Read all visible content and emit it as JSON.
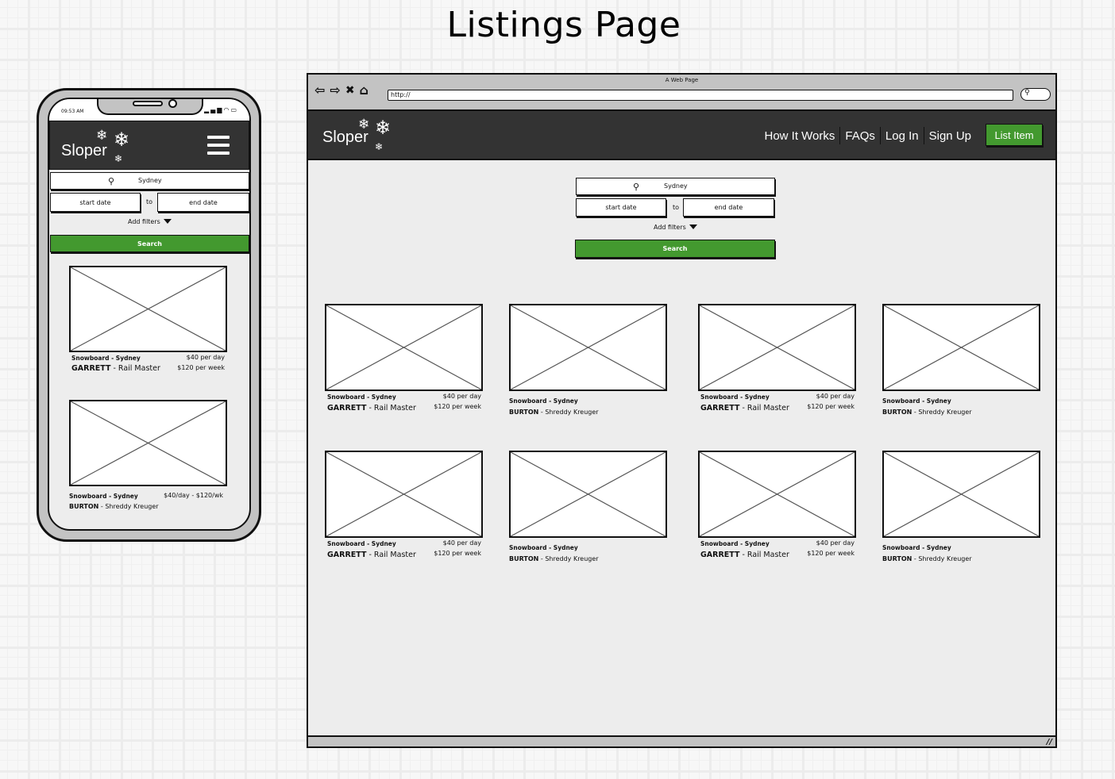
{
  "page_title": "Listings Page",
  "colors": {
    "header_bg": "#333333",
    "accent_green": "#43992f",
    "content_bg": "#ededed",
    "chrome_gray": "#c3c3c3"
  },
  "mobile": {
    "status_time": "09:53 AM",
    "status_icons": [
      "signal-icon",
      "wifi-icon",
      "battery-icon"
    ],
    "brand": "Sloper",
    "menu_icon": "hamburger-menu-icon",
    "search_value": "Sydney",
    "start_date_placeholder": "start date",
    "to_label": "to",
    "end_date_placeholder": "end date",
    "add_filters": "Add filters",
    "search_button": "Search",
    "listings": [
      {
        "category": "Snowboard - Sydney",
        "brand": "GARRETT",
        "model": " - Rail Master",
        "price_day": "$40 per day",
        "price_week": "$120 per week"
      },
      {
        "category": "Snowboard - Sydney",
        "brand": "BURTON",
        "model": " - Shreddy Kreuger",
        "price_combined": "$40/day - $120/wk"
      }
    ]
  },
  "desktop": {
    "window_title": "A Web Page",
    "url": "http://",
    "nav_buttons": [
      "back-icon",
      "forward-icon",
      "close-icon",
      "home-icon"
    ],
    "brand": "Sloper",
    "nav_links": [
      "How It Works",
      "FAQs",
      "Log In",
      "Sign Up"
    ],
    "cta_button": "List Item",
    "search_value": "Sydney",
    "start_date_placeholder": "start date",
    "to_label": "to",
    "end_date_placeholder": "end date",
    "add_filters": "Add filters",
    "search_button": "Search",
    "listings": [
      {
        "category": "Snowboard - Sydney",
        "brand": "GARRETT",
        "model": " - Rail Master",
        "price_day": "$40 per day",
        "price_week": "$120 per week"
      },
      {
        "category": "Snowboard - Sydney",
        "brand": "BURTON",
        "model": " - Shreddy Kreuger"
      },
      {
        "category": "Snowboard - Sydney",
        "brand": "GARRETT",
        "model": " - Rail Master",
        "price_day": "$40 per day",
        "price_week": "$120 per week"
      },
      {
        "category": "Snowboard - Sydney",
        "brand": "BURTON",
        "model": " - Shreddy Kreuger"
      },
      {
        "category": "Snowboard - Sydney",
        "brand": "GARRETT",
        "model": " - Rail Master",
        "price_day": "$40 per day",
        "price_week": "$120 per week"
      },
      {
        "category": "Snowboard - Sydney",
        "brand": "BURTON",
        "model": " - Shreddy Kreuger"
      },
      {
        "category": "Snowboard - Sydney",
        "brand": "GARRETT",
        "model": " - Rail Master",
        "price_day": "$40 per day",
        "price_week": "$120 per week"
      },
      {
        "category": "Snowboard - Sydney",
        "brand": "BURTON",
        "model": " - Shreddy Kreuger"
      }
    ]
  }
}
